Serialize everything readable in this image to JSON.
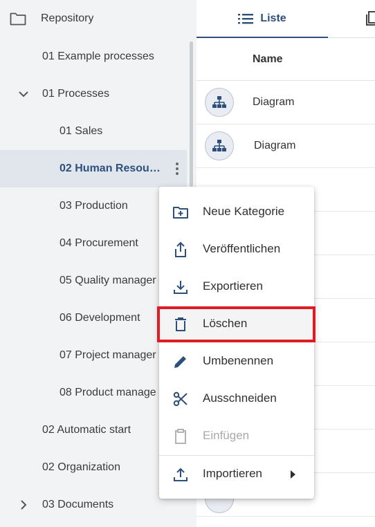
{
  "sidebar": {
    "root_label": "Repository",
    "items": [
      {
        "label": "01 Example processes",
        "indent": 1
      },
      {
        "label": "01 Processes",
        "indent": 1,
        "expanded": true
      },
      {
        "label": "01 Sales",
        "indent": 2
      },
      {
        "label": "02 Human Resour…",
        "indent": 2,
        "selected": true
      },
      {
        "label": "03 Production",
        "indent": 2
      },
      {
        "label": "04 Procurement",
        "indent": 2
      },
      {
        "label": "05 Quality manager",
        "indent": 2
      },
      {
        "label": "06 Development",
        "indent": 2
      },
      {
        "label": "07 Project manager",
        "indent": 2
      },
      {
        "label": "08 Product manage",
        "indent": 2
      },
      {
        "label": "02 Automatic start",
        "indent": 1
      },
      {
        "label": "02 Organization",
        "indent": 1
      },
      {
        "label": "03 Documents",
        "indent": 1,
        "collapsed": true
      }
    ]
  },
  "tabs": {
    "liste": "Liste"
  },
  "table": {
    "column_name": "Name",
    "rows": [
      "Diagram",
      "Diagram"
    ]
  },
  "context_menu": {
    "items": [
      {
        "label": "Neue Kategorie",
        "icon": "folder-plus-icon"
      },
      {
        "label": "Veröffentlichen",
        "icon": "share-upload-icon"
      },
      {
        "label": "Exportieren",
        "icon": "download-icon"
      },
      {
        "label": "Löschen",
        "icon": "trash-icon",
        "highlighted": true
      },
      {
        "label": "Umbenennen",
        "icon": "pencil-icon"
      },
      {
        "label": "Ausschneiden",
        "icon": "scissors-icon"
      },
      {
        "label": "Einfügen",
        "icon": "clipboard-icon",
        "disabled": true
      },
      {
        "label": "Importieren",
        "icon": "upload-icon",
        "submenu": true
      }
    ]
  },
  "colors": {
    "accent": "#2d4f7c",
    "highlight_border": "#e01b22",
    "sidebar_bg": "#f1f3f5",
    "selected_bg": "#e1e6ec"
  }
}
